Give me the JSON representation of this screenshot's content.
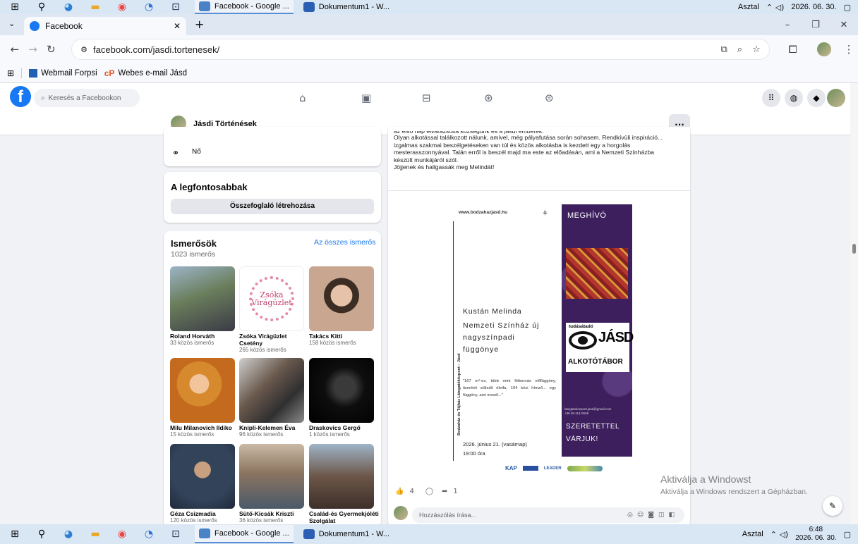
{
  "taskbar": {
    "apps": [
      "Facebook - Google ...",
      "Dokumentum1 - W..."
    ],
    "desktop_label": "Asztal",
    "date": "2026. 06. 30.",
    "time": "6:48"
  },
  "browser": {
    "tab_title": "Facebook",
    "url": "facebook.com/jasdi.tortenesek/",
    "bookmarks": [
      "Webmail Forpsi",
      "Webes e-mail Jásd"
    ]
  },
  "fb": {
    "search_placeholder": "Keresés a Facebookon",
    "page_name": "Jásdi Történések",
    "more": "..."
  },
  "intro": {
    "gender": "Nő"
  },
  "featured": {
    "title": "A legfontosabbak",
    "button": "Összefoglaló létrehozása"
  },
  "friends": {
    "title": "Ismerősök",
    "count": "1023 ismerős",
    "see_all": "Az összes ismerős",
    "items": [
      {
        "name": "Roland Horváth",
        "mutual": "33 közös ismerős"
      },
      {
        "name": "Zsóka Virágüzlet Csetény",
        "mutual": "265 közös ismerős"
      },
      {
        "name": "Takács Kitti",
        "mutual": "158 közös ismerős"
      },
      {
        "name": "Milu Milanovich Ildiko",
        "mutual": "15 közös ismerős"
      },
      {
        "name": "Knipli-Kelemen Éva",
        "mutual": "96 közös ismerős"
      },
      {
        "name": "Draskovics Gergő",
        "mutual": "1 közös ismerős"
      },
      {
        "name": "Géza Csizmadia",
        "mutual": "120 közös ismerős"
      },
      {
        "name": "Sütő-Kicsák Kriszti",
        "mutual": "36 közös ismerős"
      },
      {
        "name": "Család-és Gyermekjóléti Szolgálat",
        "mutual": ""
      }
    ]
  },
  "post": {
    "lines": [
      "az első nap elvarázsolta községünk és a jásdi emberek.",
      "Olyan alkotással találkozott nálunk, amivel, még pályafutása során sohasem. Rendkívüli inspiráció...",
      "izgalmas szakmai beszélgetéseken van túl és közös alkotásba is kezdett egy a horgolás",
      "mesterasszonnyával. Talán erről is beszél majd ma este az előadásán, ami a Nemzeti Színházba",
      "készült munkájáról szól.",
      "Jöjjenek és hallgassák meg Melindát!"
    ],
    "likes": "4",
    "shares": "1",
    "comment_placeholder": "Hozzászólás írása..."
  },
  "flyer": {
    "website": "www.bodzahazjasd.hu",
    "invite": "MEGHÍVÓ",
    "person": "Kustán Melinda",
    "talk_title": [
      "Nemzeti Színház új",
      "nagyszínpadi",
      "függönye"
    ],
    "quote": "\"167 m²-es, több mint féltonnás előfüggöny, tizenkét stílizált életfa, 104 kézi hímző... egy függöny, ami mesél...\"",
    "side_text": "Bodzaház és Tájház Látogatóközpont – Jásd",
    "date": "2026. június 21. (vasárnap)",
    "time": "19:00 óra",
    "brand_top": "tudásátadó",
    "brand_main": "JÁSD",
    "brand_sub": "ALKOTÓTÁBOR",
    "email": "latogatokozpont.jasd@gmail.com",
    "phone": "+36 30-114-0636",
    "closing": [
      "SZERETETTEL",
      "VÁRJUK!"
    ],
    "logos": [
      "KAP",
      "LEADER"
    ]
  },
  "activation": {
    "title": "Aktiválja a Windowst",
    "subtitle": "Aktiválja a Windows rendszert a Gépházban."
  },
  "colors": {
    "fb_blue": "#1877f2",
    "purple": "#3d1f5e"
  }
}
